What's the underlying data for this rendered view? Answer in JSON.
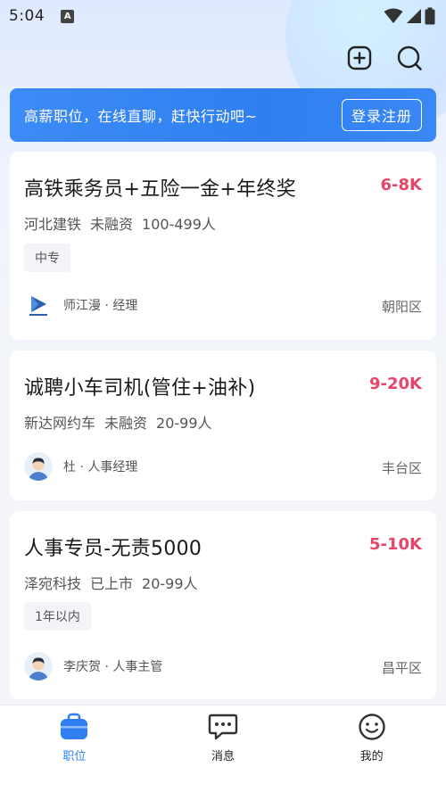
{
  "status": {
    "time": "5:04",
    "notif_icon": "A"
  },
  "banner": {
    "text": "高薪职位，在线直聊，赶快行动吧~",
    "button": "登录注册"
  },
  "jobs": [
    {
      "title": "高铁乘务员+五险一金+年终奖",
      "salary": "6-8K",
      "company": "河北建铁",
      "funding": "未融资",
      "size": "100-499人",
      "tag": "中专",
      "recruiter": "师江漫 · 经理",
      "district": "朝阳区"
    },
    {
      "title": "诚聘小车司机(管住+油补)",
      "salary": "9-20K",
      "company": "新达网约车",
      "funding": "未融资",
      "size": "20-99人",
      "recruiter": "杜 · 人事经理",
      "district": "丰台区"
    },
    {
      "title": "人事专员-无责5000",
      "salary": "5-10K",
      "company": "泽宛科技",
      "funding": "已上市",
      "size": "20-99人",
      "tag": "1年以内",
      "recruiter": "李庆贺 · 人事主管",
      "district": "昌平区"
    }
  ],
  "tabs": [
    {
      "label": "职位",
      "icon": "briefcase-icon",
      "active": true
    },
    {
      "label": "消息",
      "icon": "chat-icon",
      "active": false
    },
    {
      "label": "我的",
      "icon": "smile-icon",
      "active": false
    }
  ],
  "colors": {
    "accent": "#2f7ff0",
    "salary": "#e8456b"
  }
}
